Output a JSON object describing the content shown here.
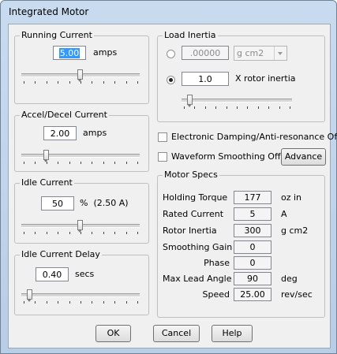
{
  "window": {
    "title": "Integrated Motor"
  },
  "running_current": {
    "title": "Running Current",
    "value": "5.00",
    "unit": "amps",
    "slider_level": 0.5
  },
  "accel_current": {
    "title": "Accel/Decel Current",
    "value": "2.00",
    "unit": "amps",
    "slider_level": 0.2
  },
  "idle_current": {
    "title": "Idle Current",
    "value": "50",
    "unit": "%  (2.50 A)",
    "slider_level": 0.5
  },
  "idle_delay": {
    "title": "Idle Current Delay",
    "value": "0.40",
    "unit": "secs",
    "slider_level": 0.05
  },
  "load_inertia": {
    "title": "Load Inertia",
    "option1_value": ".00000",
    "option1_unit": "g cm2",
    "option2_value": "1.0",
    "option2_label": "X rotor inertia",
    "selected": "option2",
    "slider_level": 0.05
  },
  "damping_label": "Electronic Damping/Anti-resonance Off",
  "smoothing_label": "Waveform Smoothing Off",
  "advance_label": "Advance",
  "motor_specs": {
    "title": "Motor Specs",
    "rows": [
      {
        "label": "Holding Torque",
        "value": "177",
        "unit": "oz in"
      },
      {
        "label": "Rated Current",
        "value": "5",
        "unit": "A"
      },
      {
        "label": "Rotor Inertia",
        "value": "300",
        "unit": "g cm2"
      },
      {
        "label": "Smoothing Gain",
        "value": "0",
        "unit": ""
      },
      {
        "label": "Phase",
        "value": "0",
        "unit": ""
      },
      {
        "label": "Max Lead Angle",
        "value": "90",
        "unit": "deg"
      },
      {
        "label": "Speed",
        "value": "25.00",
        "unit": "rev/sec"
      }
    ]
  },
  "buttons": {
    "ok": "OK",
    "cancel": "Cancel",
    "help": "Help"
  }
}
